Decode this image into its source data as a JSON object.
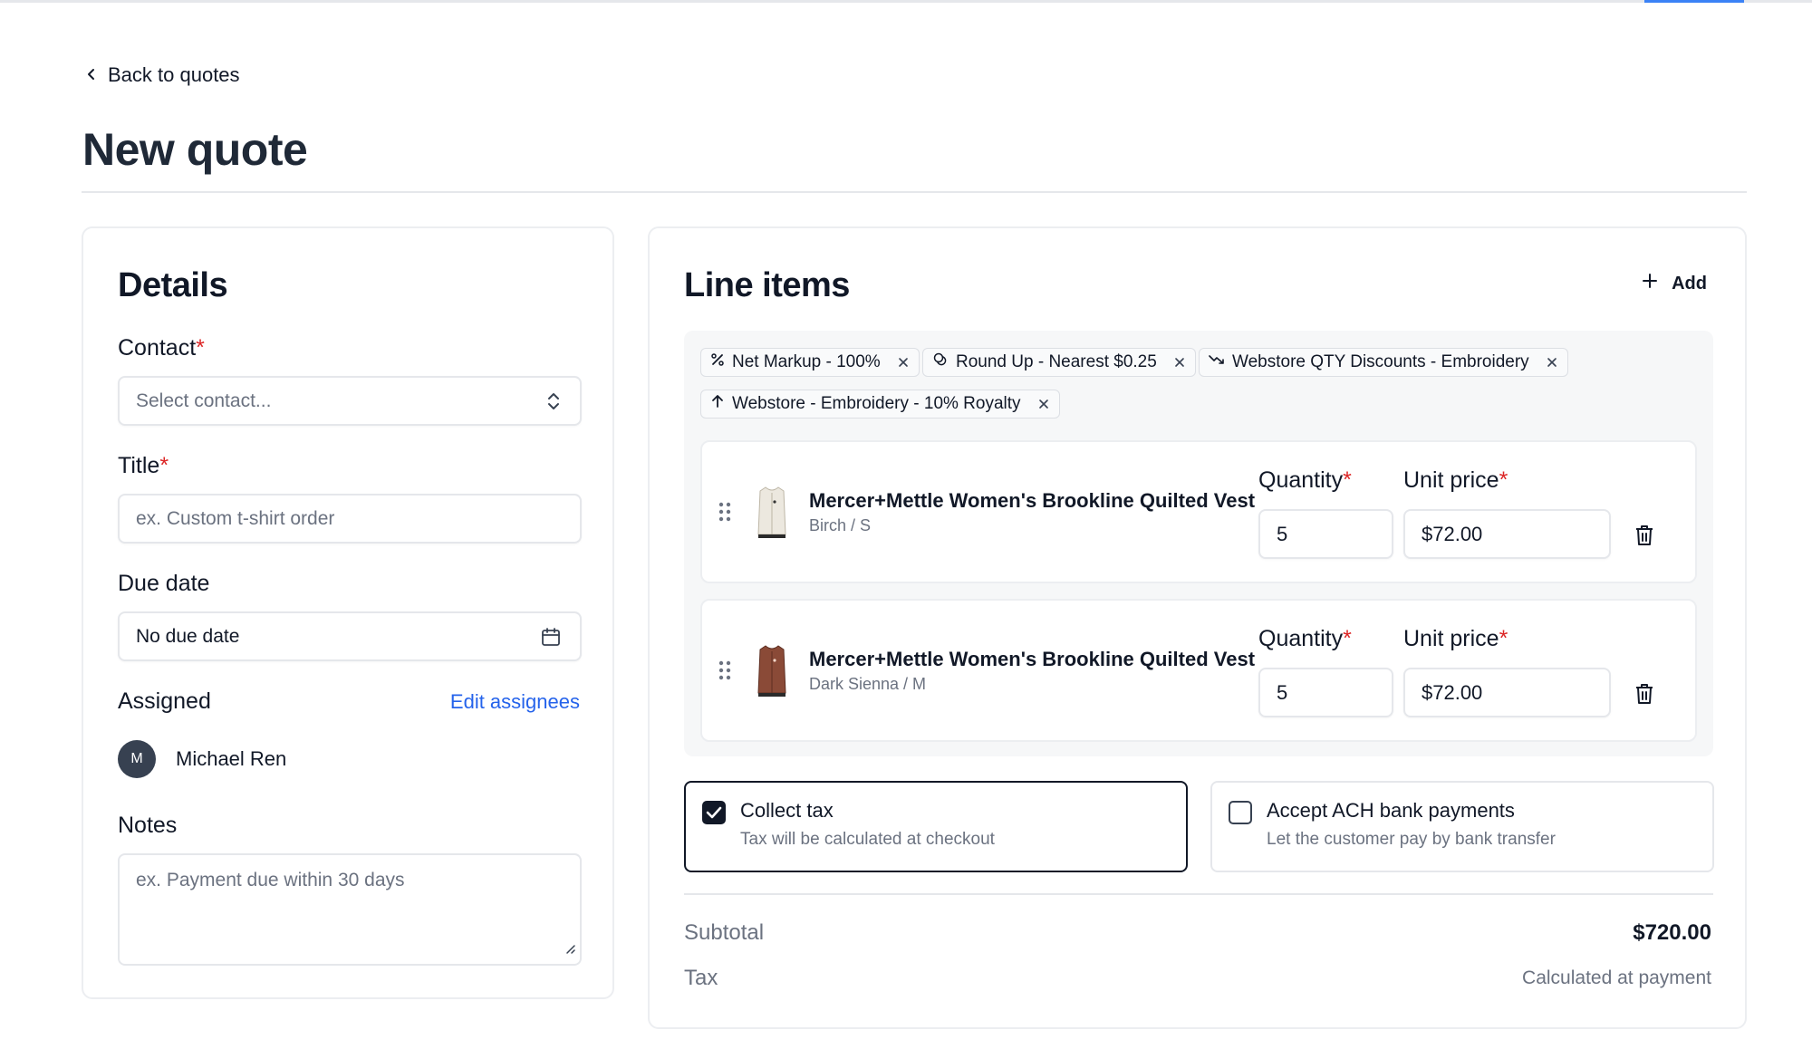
{
  "nav": {
    "back_label": "Back to quotes"
  },
  "page": {
    "title": "New quote"
  },
  "details": {
    "title": "Details",
    "contact_label": "Contact",
    "contact_placeholder": "Select contact...",
    "title_label": "Title",
    "title_placeholder": "ex. Custom t-shirt order",
    "due_date_label": "Due date",
    "due_date_value": "No due date",
    "assigned_label": "Assigned",
    "edit_assignees_label": "Edit assignees",
    "assignee": {
      "initial": "M",
      "name": "Michael Ren"
    },
    "notes_label": "Notes",
    "notes_placeholder": "ex. Payment due within 30 days",
    "required_mark": "*"
  },
  "line_items": {
    "title": "Line items",
    "add_label": "Add",
    "rules": [
      {
        "icon": "percent-icon",
        "label": "Net Markup - 100%"
      },
      {
        "icon": "coins-icon",
        "label": "Round Up - Nearest $0.25"
      },
      {
        "icon": "trend-down-icon",
        "label": "Webstore QTY Discounts - Embroidery"
      },
      {
        "icon": "arrow-up-icon",
        "label": "Webstore - Embroidery - 10% Royalty"
      }
    ],
    "quantity_label": "Quantity",
    "unit_price_label": "Unit price",
    "items": [
      {
        "name": "Mercer+Mettle Women's Brookline Quilted Vest",
        "variant": "Birch / S",
        "quantity": "5",
        "unit_price": "$72.00",
        "thumb_color": "#ece8df"
      },
      {
        "name": "Mercer+Mettle Women's Brookline Quilted Vest",
        "variant": "Dark Sienna / M",
        "quantity": "5",
        "unit_price": "$72.00",
        "thumb_color": "#8a4a37"
      }
    ]
  },
  "options": {
    "collect_tax": {
      "title": "Collect tax",
      "description": "Tax will be calculated at checkout",
      "checked": true
    },
    "ach": {
      "title": "Accept ACH bank payments",
      "description": "Let the customer pay by bank transfer",
      "checked": false
    }
  },
  "summary": {
    "subtotal_label": "Subtotal",
    "subtotal_value": "$720.00",
    "tax_label": "Tax",
    "tax_value": "Calculated at payment"
  },
  "colors": {
    "accent": "#2563eb",
    "required": "#dc2626",
    "dark": "#111827"
  }
}
